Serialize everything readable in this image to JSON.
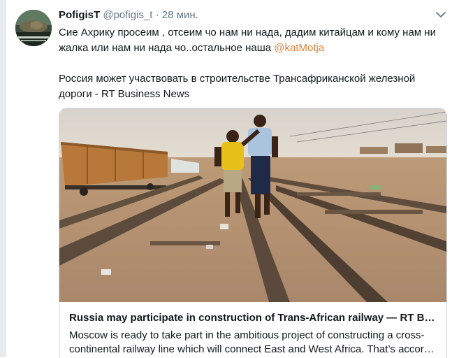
{
  "tweet": {
    "author_name": "PofigisT",
    "author_handle": "@pofigis_t",
    "separator": "·",
    "timestamp": "28 мин.",
    "text_line1": "Сие Ахрику просеим , отсеим чо нам ни нада, дадим китайцам и кому нам ни",
    "text_line2_before": "жалка или нам ни нада чо..остальное наша ",
    "mention": "@katMotja",
    "text_line3": "Россия может участвовать в строительстве Трансафриканской железной",
    "text_line4": "дороги - RT Business News"
  },
  "card": {
    "title": "Russia may participate in construction of Trans-African railway — RT Bu…",
    "description": "Moscow is ready to take part in the ambitious project of constructing a cross-continental railway line which will connect East and West Africa. That’s accor…"
  },
  "colors": {
    "mention": "#e0813a",
    "secondary_text": "#657786",
    "card_border": "#ccd6dd"
  },
  "icons": {
    "more_menu": "chevron-down-icon"
  }
}
